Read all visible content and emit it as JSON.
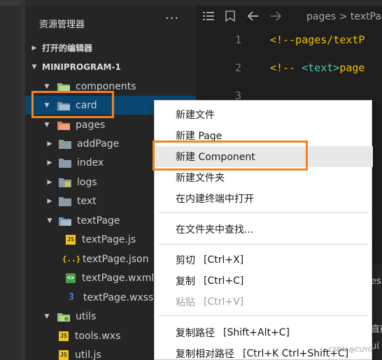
{
  "explorer": {
    "title": "资源管理器",
    "more": "···",
    "open_editors": "打开的编辑器",
    "project": "MINIPROGRAM-1"
  },
  "tree": {
    "components": "components",
    "card": "card",
    "pages": "pages",
    "addPage": "addPage",
    "index": "index",
    "logs": "logs",
    "text": "text",
    "textPage": "textPage",
    "textPage_js": "textPage.js",
    "textPage_json": "textPage.json",
    "textPage_wxml": "textPage.wxml",
    "textPage_wxss": "textPage.wxss",
    "utils": "utils",
    "tools_wxs": "tools.wxs",
    "util_js": "util.js"
  },
  "file_badges": {
    "js": "JS",
    "json": "{..}",
    "wxml": "<>",
    "wxss": "3"
  },
  "editor": {
    "breadcrumb_pages": "pages",
    "breadcrumb_sep": ">",
    "breadcrumb_file": "textPa",
    "line1": "1",
    "line2": "2",
    "line3": "3",
    "code1": "<!--pages/textP",
    "code2_open": "<!-- ",
    "code2_tag": "<text>",
    "code2_rest": "page",
    "side_fragment_1": "es",
    "side_fragment_2": "直截",
    "side_fragment_3": "ui"
  },
  "context_menu": {
    "new_file": "新建文件",
    "new_page": "新建 Page",
    "new_component": "新建 Component",
    "new_folder": "新建文件夹",
    "open_in_terminal": "在内建终端中打开",
    "find_in_folder": "在文件夹中查找...",
    "cut": "剪切",
    "cut_shortcut": "[Ctrl+X]",
    "copy": "复制",
    "copy_shortcut": "[Ctrl+C]",
    "paste": "粘贴",
    "paste_shortcut": "[Ctrl+V]",
    "copy_path": "复制路径",
    "copy_path_shortcut": "[Shift+Alt+C]",
    "copy_relative_path": "复制相对路径",
    "copy_relative_path_shortcut": "[Ctrl+K Ctrl+Shift+C]"
  },
  "watermark": "CSDN @CUYG",
  "colors": {
    "highlight": "#f5821f",
    "selection": "#094771",
    "sidebar": "#252526",
    "editor": "#1e1e1e"
  }
}
